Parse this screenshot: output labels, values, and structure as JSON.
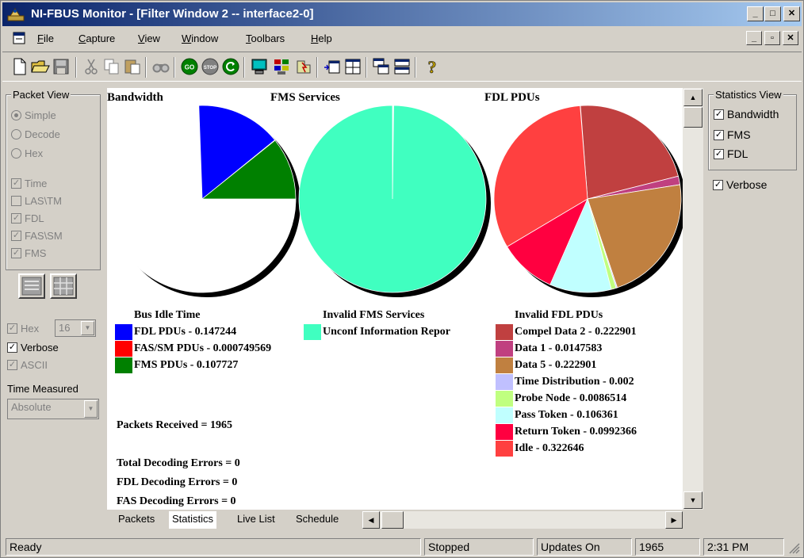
{
  "window": {
    "title": "NI-FBUS Monitor - [Filter Window 2 -- interface2-0]"
  },
  "menu": {
    "items": [
      {
        "label": "File",
        "accel": "F",
        "rest": "ile"
      },
      {
        "label": "Capture",
        "accel": "C",
        "rest": "apture"
      },
      {
        "label": "View",
        "accel": "V",
        "rest": "iew"
      },
      {
        "label": "Window",
        "accel": "W",
        "rest": "indow"
      },
      {
        "label": "Toolbars",
        "accel": "T",
        "rest": "oolbars"
      },
      {
        "label": "Help",
        "accel": "H",
        "rest": "elp"
      }
    ]
  },
  "toolbar": {
    "icons": [
      "new-file-icon",
      "open-folder-icon",
      "save-icon",
      "cut-icon",
      "copy-icon",
      "paste-icon",
      "find-icon",
      "go-icon",
      "stop-icon",
      "refresh-icon",
      "monitor-icon",
      "filter-icon",
      "trigger-icon",
      "insert-window-icon",
      "grid-icon",
      "cascade-icon",
      "tile-icon",
      "help-icon"
    ],
    "go_label": "GO",
    "stop_label": "STOP",
    "help_glyph": "?"
  },
  "packet_view": {
    "title": "Packet View",
    "modes": [
      "Simple",
      "Decode",
      "Hex"
    ],
    "selected_mode": "Simple",
    "filters": [
      {
        "label": "Time",
        "checked": true
      },
      {
        "label": "LAS\\TM",
        "checked": false
      },
      {
        "label": "FDL",
        "checked": true
      },
      {
        "label": "FAS\\SM",
        "checked": true
      },
      {
        "label": "FMS",
        "checked": true
      }
    ],
    "hex_label": "Hex",
    "hex_value": "16",
    "verbose_label": "Verbose",
    "ascii_label": "ASCII",
    "time_measured_label": "Time Measured",
    "time_measured_value": "Absolute"
  },
  "colors": {
    "bus_idle": "#ffffff",
    "fdl_pdus": "#0000ff",
    "fas_sm_pdus": "#ff0000",
    "fms_pdus": "#008000",
    "unconf_info": "#40ffc0",
    "compel_data_2": "#c04040",
    "data_1": "#c04080",
    "data_5": "#c08040",
    "time_distribution": "#c0c0ff",
    "probe_node": "#c0ff80",
    "pass_token": "#c0ffff",
    "return_token": "#ff0040",
    "idle": "#ff4040"
  },
  "chart_data": [
    {
      "type": "pie",
      "title": "Bandwidth",
      "slices": [
        {
          "label": "Bus Idle Time",
          "value": 0.74428,
          "color": "#ffffff"
        },
        {
          "label": "FDL PDUs - 0.147244",
          "value": 0.147244,
          "color": "#0000ff"
        },
        {
          "label": "FAS/SM PDUs - 0.000749569",
          "value": 0.000749569,
          "color": "#ff0000"
        },
        {
          "label": "FMS PDUs - 0.107727",
          "value": 0.107727,
          "color": "#008000"
        }
      ]
    },
    {
      "type": "pie",
      "title": "FMS Services",
      "slices": [
        {
          "label": "Invalid FMS Services",
          "value": 0.002,
          "color": "#ffffff"
        },
        {
          "label": "Unconf Information Repor",
          "value": 0.998,
          "color": "#40ffc0"
        }
      ]
    },
    {
      "type": "pie",
      "title": "FDL PDUs",
      "slices": [
        {
          "label": "Invalid FDL PDUs",
          "value": 0.0005,
          "color": "#ffffff"
        },
        {
          "label": "Compel Data 2 - 0.222901",
          "value": 0.222901,
          "color": "#c04040"
        },
        {
          "label": "Data 1 - 0.0147583",
          "value": 0.0147583,
          "color": "#c04080"
        },
        {
          "label": "Data 5 - 0.222901",
          "value": 0.222901,
          "color": "#c08040"
        },
        {
          "label": "Time Distribution - 0.002",
          "value": 0.002,
          "color": "#c0c0ff"
        },
        {
          "label": "Probe Node - 0.0086514",
          "value": 0.0086514,
          "color": "#c0ff80"
        },
        {
          "label": "Pass Token - 0.106361",
          "value": 0.106361,
          "color": "#c0ffff"
        },
        {
          "label": "Return Token - 0.0992366",
          "value": 0.0992366,
          "color": "#ff0040"
        },
        {
          "label": "Idle - 0.322646",
          "value": 0.322646,
          "color": "#ff4040"
        }
      ]
    }
  ],
  "stats": {
    "packets_received": "Packets Received = 1965",
    "total_errors": "Total Decoding Errors = 0",
    "fdl_errors": "FDL Decoding Errors = 0",
    "fas_errors": "FAS Decoding Errors = 0"
  },
  "tabs": [
    "Packets",
    "Statistics",
    "Live List",
    "Schedule"
  ],
  "active_tab": "Statistics",
  "statistics_view": {
    "title": "Statistics View",
    "items": [
      {
        "label": "Bandwidth",
        "checked": true
      },
      {
        "label": "FMS",
        "checked": true
      },
      {
        "label": "FDL",
        "checked": true
      }
    ],
    "verbose_label": "Verbose",
    "verbose_checked": true
  },
  "status": {
    "state": "Ready",
    "capture": "Stopped",
    "updates": "Updates On",
    "count": "1965",
    "time": "2:31 PM"
  }
}
